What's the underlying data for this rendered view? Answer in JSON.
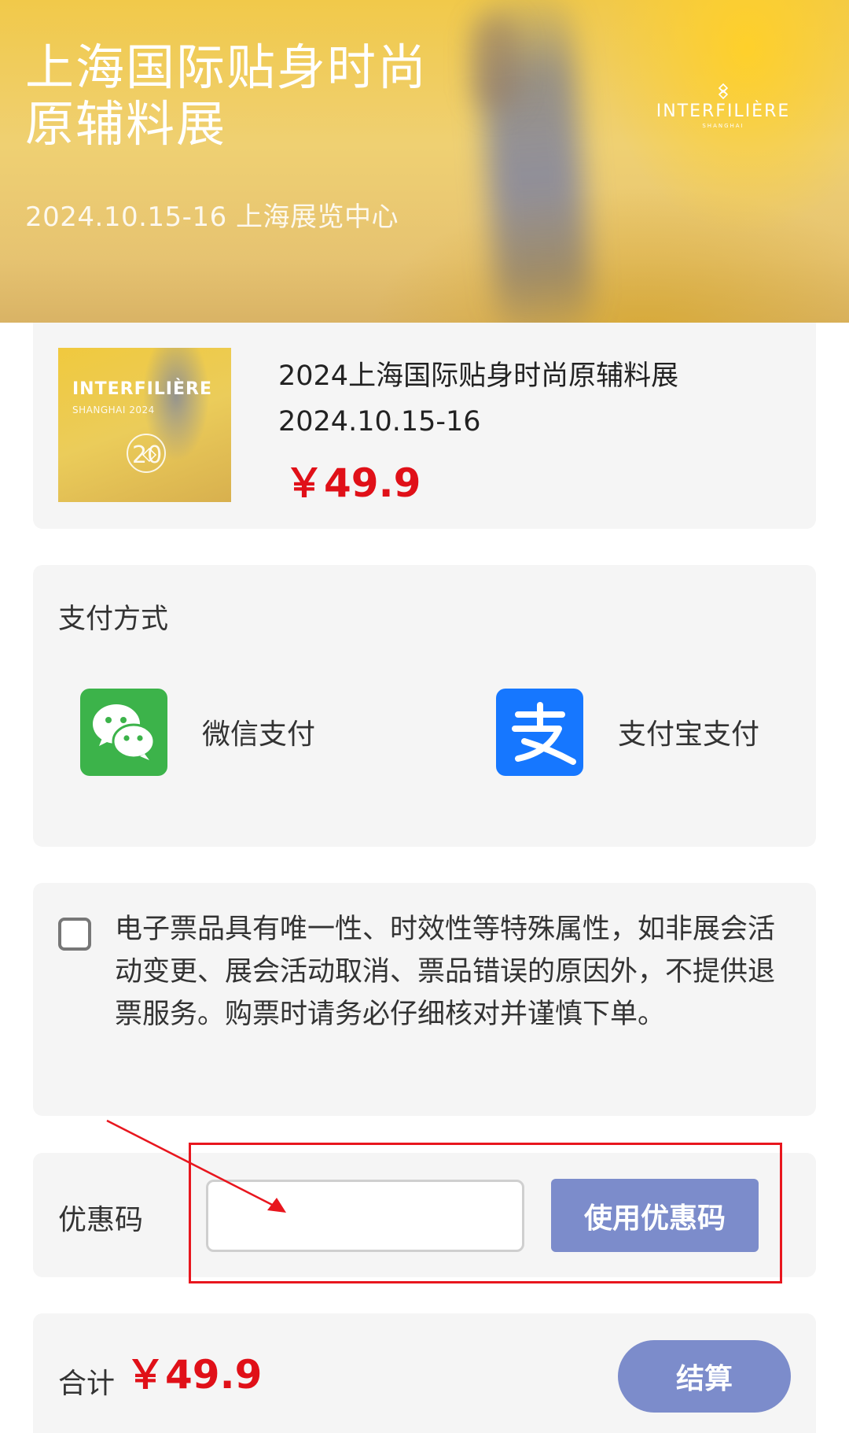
{
  "banner": {
    "title": "上海国际贴身时尚原辅料展",
    "subtitle": "2024.10.15-16 上海展览中心",
    "brand_name": "INTERFILIÈRE",
    "brand_city": "SHANGHAI"
  },
  "product": {
    "thumb_brand": "INTERFILIÈRE",
    "thumb_edition": "SHANGHAI 2024",
    "thumb_anniversary": "20",
    "name": "2024上海国际贴身时尚原辅料展",
    "date": "2024.10.15-16",
    "price": "￥49.9"
  },
  "payment": {
    "title": "支付方式",
    "options": [
      {
        "label": "微信支付",
        "icon": "wechat-icon"
      },
      {
        "label": "支付宝支付",
        "icon": "alipay-icon"
      }
    ]
  },
  "terms": {
    "checked": false,
    "text": "电子票品具有唯一性、时效性等特殊属性，如非展会活动变更、展会活动取消、票品错误的原因外，不提供退票服务。购票时请务必仔细核对并谨慎下单。"
  },
  "coupon": {
    "label": "优惠码",
    "input_value": "",
    "button_label": "使用优惠码"
  },
  "summary": {
    "total_label": "合计",
    "total_price": "￥49.9",
    "checkout_label": "结算"
  },
  "colors": {
    "price_red": "#e01018",
    "button_purple": "#7c8ccb",
    "wechat_green": "#3cb34a",
    "alipay_blue": "#1677ff",
    "annotation_red": "#e8161e"
  }
}
